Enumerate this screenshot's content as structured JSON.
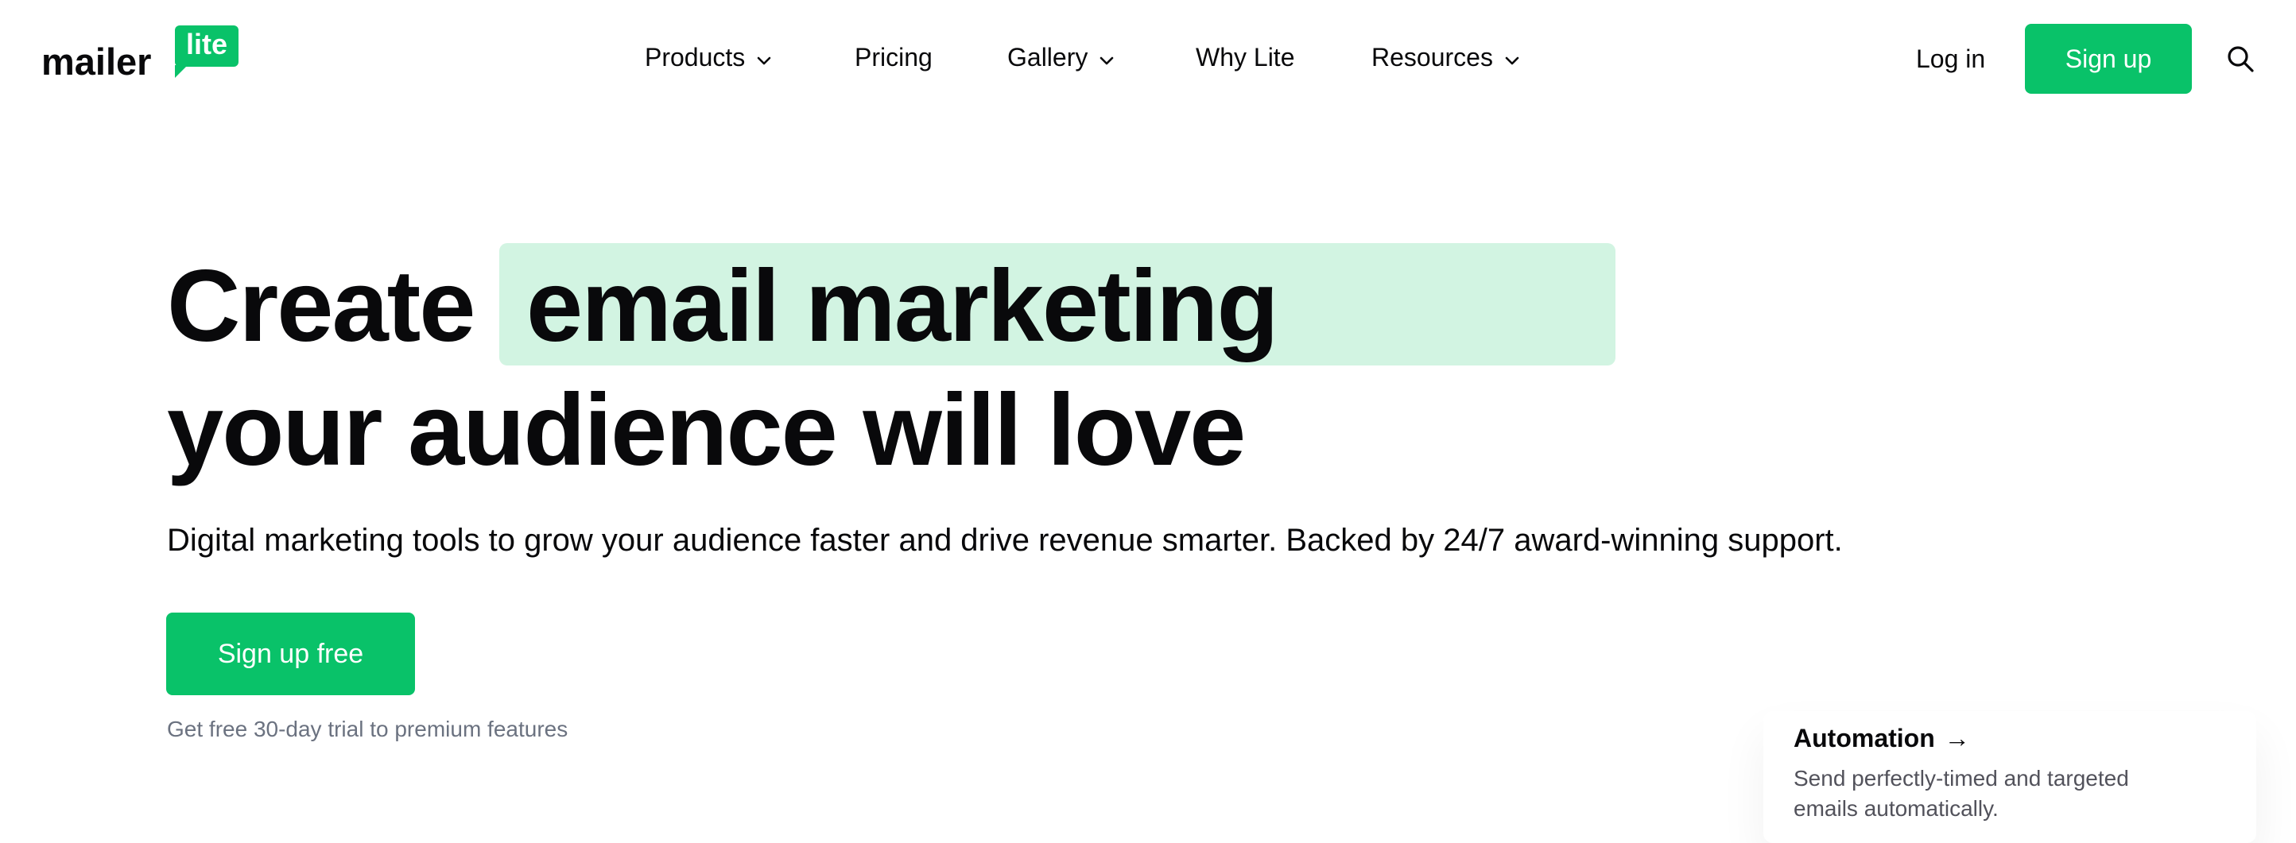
{
  "header": {
    "logo_word": "mailer",
    "logo_badge": "lite",
    "nav": [
      {
        "label": "Products",
        "has_dropdown": true
      },
      {
        "label": "Pricing",
        "has_dropdown": false
      },
      {
        "label": "Gallery",
        "has_dropdown": true
      },
      {
        "label": "Why Lite",
        "has_dropdown": false
      },
      {
        "label": "Resources",
        "has_dropdown": true
      }
    ],
    "login_label": "Log in",
    "signup_label": "Sign up",
    "search_icon": "search-icon"
  },
  "hero": {
    "title_start": "Create",
    "title_highlight": "email marketing",
    "title_line2": "your audience will love",
    "subtitle": "Digital marketing tools to grow your audience faster and drive revenue smarter. Backed by 24/7 award-winning support.",
    "cta_label": "Sign up free",
    "trial_note": "Get free 30-day trial to premium features"
  },
  "feature_card": {
    "title": "Automation",
    "arrow": "→",
    "description": "Send perfectly-timed and targeted emails automatically."
  },
  "colors": {
    "brand_green": "#09c269",
    "highlight_green": "#d2f4e2",
    "text_dark": "#09090b",
    "text_muted": "#6b7280"
  }
}
